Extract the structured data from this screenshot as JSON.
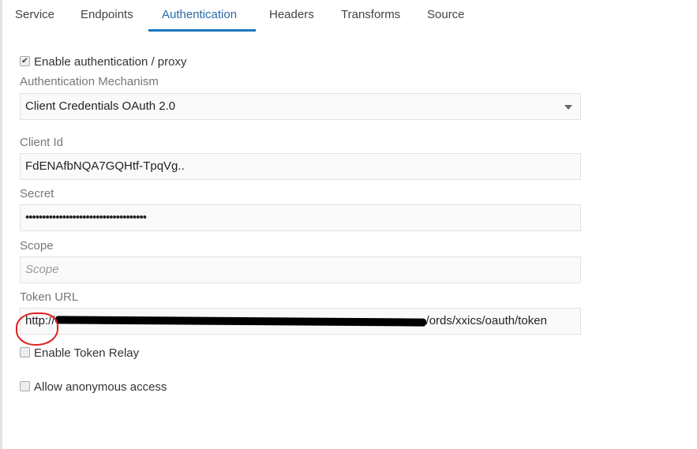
{
  "tabs": [
    {
      "label": "Service"
    },
    {
      "label": "Endpoints"
    },
    {
      "label": "Authentication",
      "active": true
    },
    {
      "label": "Headers"
    },
    {
      "label": "Transforms"
    },
    {
      "label": "Source"
    }
  ],
  "enable_auth": {
    "label": "Enable authentication / proxy",
    "checked": true
  },
  "mechanism": {
    "label": "Authentication Mechanism",
    "value": "Client Credentials OAuth 2.0"
  },
  "client_id": {
    "label": "Client Id",
    "value": "FdENAfbNQA7GQHtf-TpqVg.."
  },
  "secret": {
    "label": "Secret",
    "value": "••••••••••••••••••••••••••••••••••••"
  },
  "scope": {
    "label": "Scope",
    "placeholder": "Scope"
  },
  "token_url": {
    "label": "Token URL",
    "prefix": "http://",
    "suffix": "/ords/xxics/oauth/token"
  },
  "token_relay": {
    "label": "Enable Token Relay",
    "checked": false
  },
  "anonymous": {
    "label": "Allow anonymous access",
    "checked": false
  },
  "colors": {
    "accent": "#1a76c0",
    "annotation": "#e02020"
  }
}
